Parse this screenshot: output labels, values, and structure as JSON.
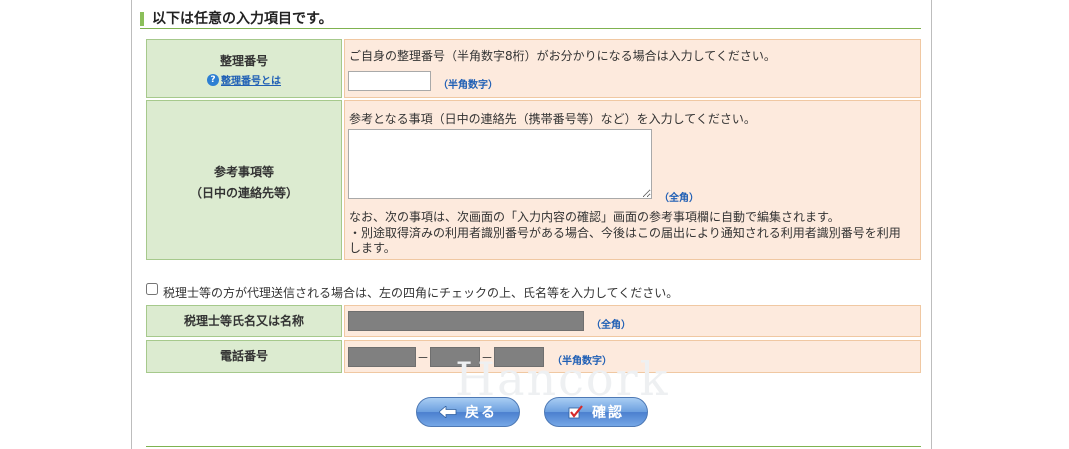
{
  "section": {
    "title": "以下は任意の入力項目です。"
  },
  "seiri": {
    "label": "整理番号",
    "help_link": "整理番号とは",
    "instruction": "ご自身の整理番号（半角数字8桁）がお分かりになる場合は入力してください。",
    "hint": "（半角数字）",
    "value": ""
  },
  "sanko": {
    "label_line1": "参考事項等",
    "label_line2": "（日中の連絡先等）",
    "instruction": "参考となる事項（日中の連絡先（携帯番号等）など）を入力してください。",
    "hint": "（全角）",
    "note_line1": "なお、次の事項は、次画面の「入力内容の確認」画面の参考事項欄に自動で編集されます。",
    "note_line2": "・別途取得済みの利用者識別番号がある場合、今後はこの届出により通知される利用者識別番号を利用",
    "note_line3": "します。",
    "value": ""
  },
  "proxy": {
    "checkbox_label": "税理士等の方が代理送信される場合は、左の四角にチェックの上、氏名等を入力してください。",
    "checked": false
  },
  "tax_name": {
    "label": "税理士等氏名又は名称",
    "hint": "（全角）"
  },
  "phone": {
    "label": "電話番号",
    "separator": "－",
    "hint": "（半角数字）"
  },
  "buttons": {
    "back": "戻る",
    "confirm": "確認"
  },
  "watermark": "Hancork"
}
